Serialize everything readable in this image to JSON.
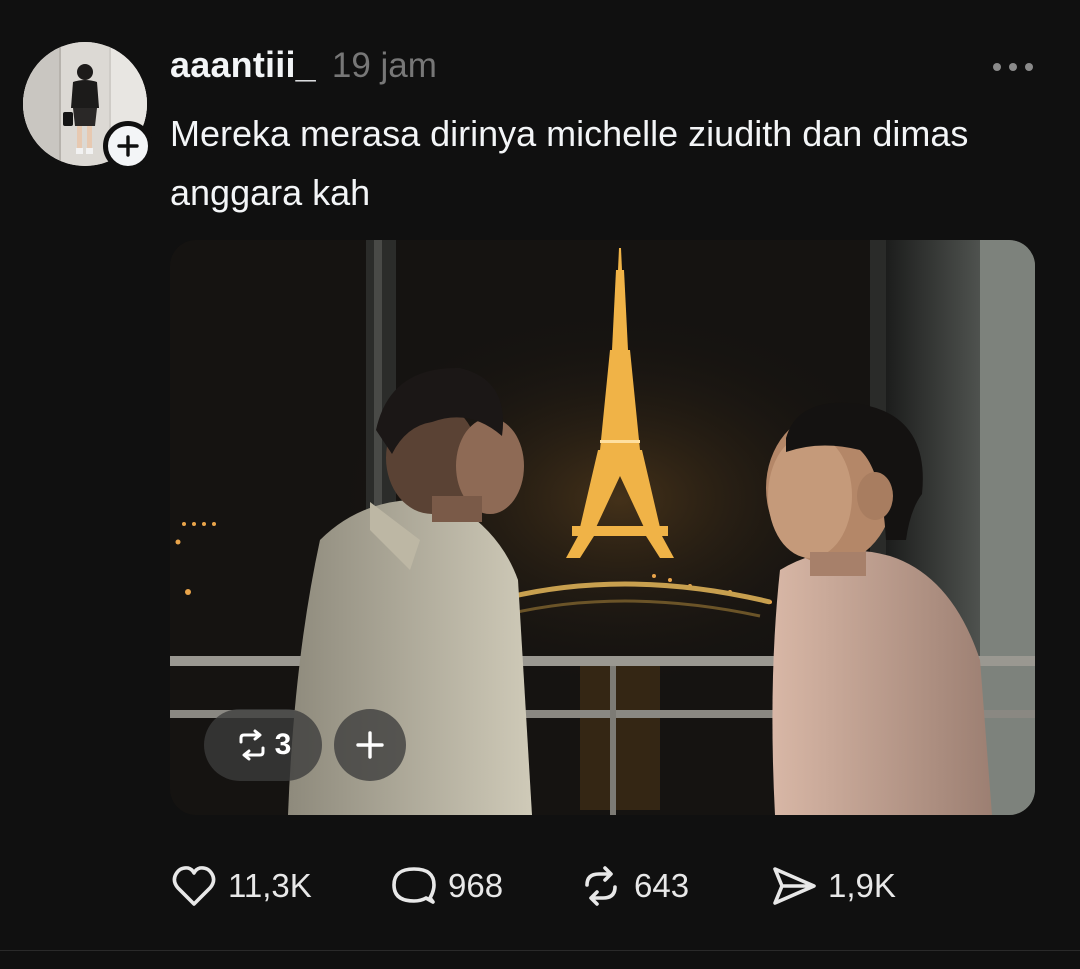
{
  "post": {
    "username": "aaantiii_",
    "time": "19 jam",
    "caption": "Mereka merasa dirinya michelle ziudith dan dimas anggara kah",
    "media": {
      "repost_count": "3"
    },
    "actions": {
      "likes": "11,3K",
      "comments": "968",
      "reposts": "643",
      "shares": "1,9K"
    }
  },
  "icons": {
    "more": "more-horizontal-icon",
    "follow": "plus-icon",
    "like": "heart-icon",
    "comment": "comment-bubble-icon",
    "repost": "repost-icon",
    "share": "send-icon"
  },
  "colors": {
    "background": "#101010",
    "text_primary": "#f3f5f7",
    "text_secondary": "#777777"
  }
}
